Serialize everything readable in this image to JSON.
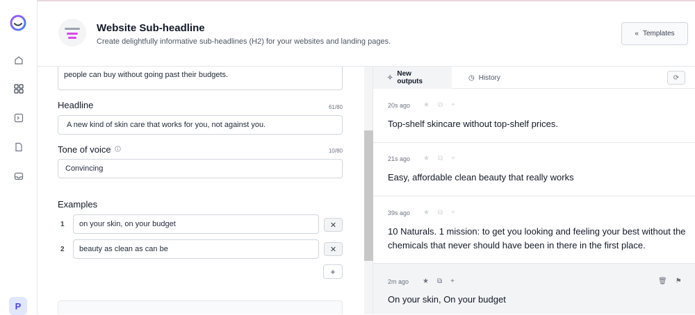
{
  "rail": {
    "avatar_letter": "P",
    "icons": [
      "home-icon",
      "apps-grid-icon",
      "terminal-icon",
      "document-icon",
      "inbox-icon"
    ]
  },
  "header": {
    "title": "Website Sub-headline",
    "subtitle": "Create delightfully informative sub-headlines (H2) for your websites and landing pages.",
    "templates_label": "Templates"
  },
  "form": {
    "description_tail": "people can buy without going past their budgets.",
    "headline": {
      "label": "Headline",
      "counter": "61/80",
      "value": "A new kind of skin care that works for you, not against you."
    },
    "tone": {
      "label": "Tone of voice",
      "counter": "10/80",
      "value": "Convincing"
    },
    "examples": {
      "label": "Examples",
      "items": [
        {
          "num": "1",
          "value": "on your skin, on your budget",
          "remove": "✕"
        },
        {
          "num": "2",
          "value": "beauty as clean as can be",
          "remove": "✕"
        }
      ],
      "add": "+"
    }
  },
  "outputs": {
    "tabs": {
      "new": "New outputs",
      "history": "History"
    },
    "items": [
      {
        "time": "20s ago",
        "text": "Top-shelf skincare without top-shelf prices."
      },
      {
        "time": "21s ago",
        "text": "Easy, affordable clean beauty that really works"
      },
      {
        "time": "39s ago",
        "text": "10 Naturals. 1 mission: to get you looking and feeling your best without the chemicals that never should have been in there in the first place."
      },
      {
        "time": "2m ago",
        "text": "On your skin, On your budget"
      }
    ]
  }
}
